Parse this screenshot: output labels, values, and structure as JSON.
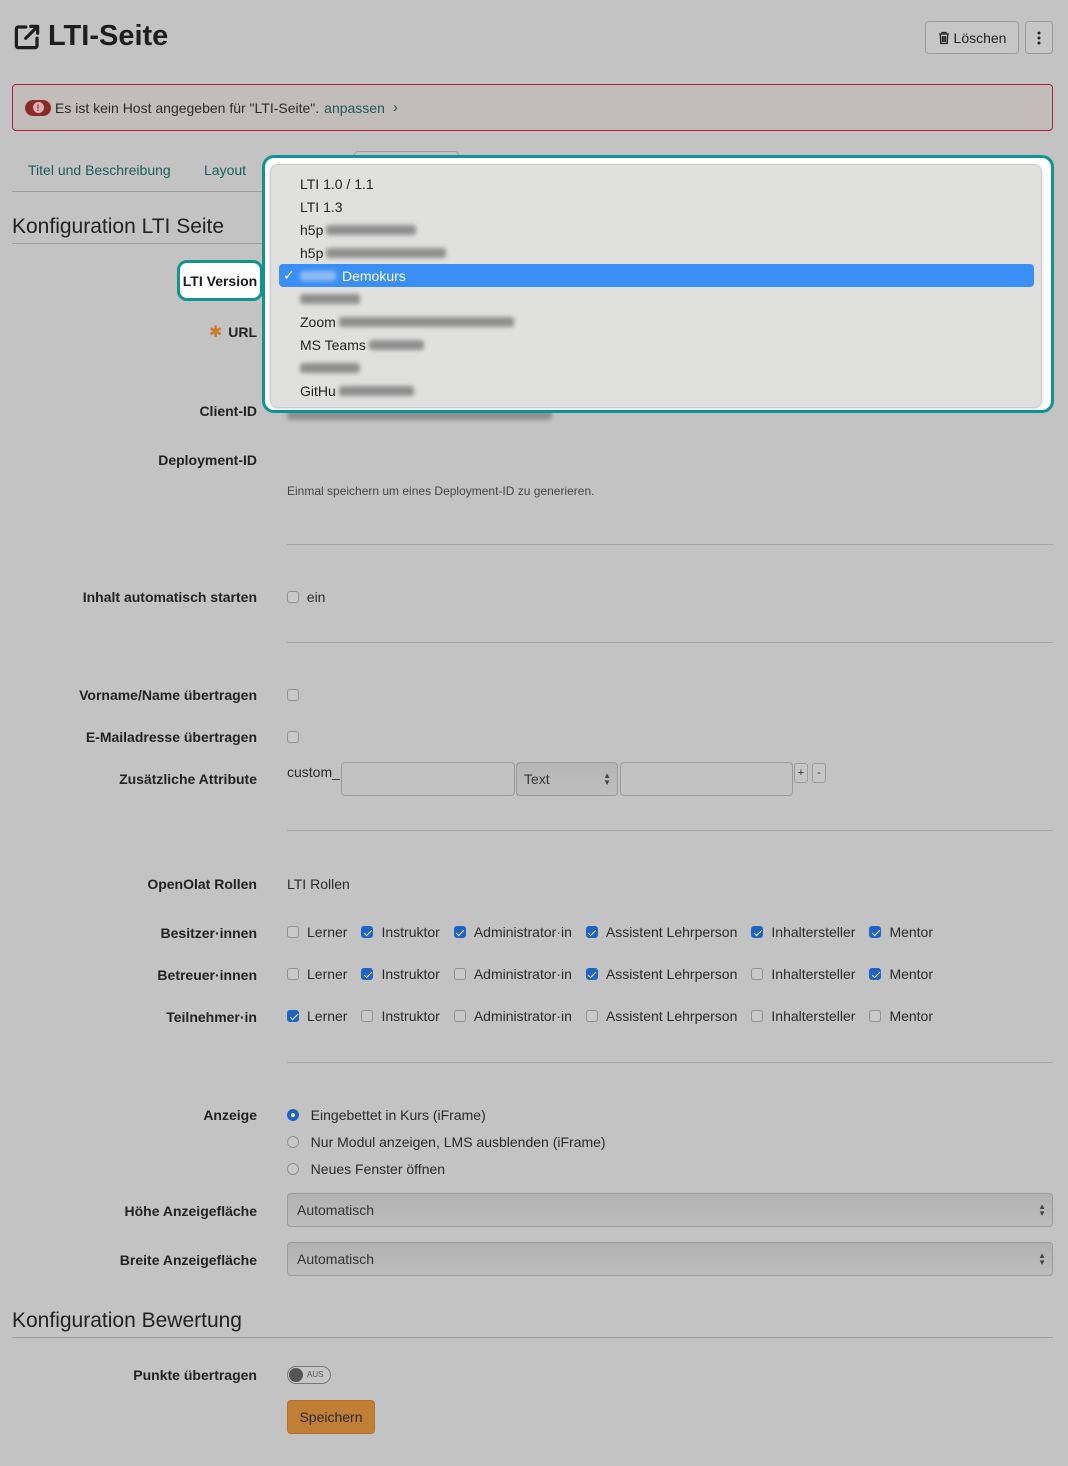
{
  "header": {
    "title": "LTI-Seite",
    "delete_label": "Löschen"
  },
  "alert": {
    "message": "Es ist kein Host angegeben für \"LTI-Seite\".",
    "link": "anpassen"
  },
  "tabs": [
    {
      "label": "Titel und Beschreibung"
    },
    {
      "label": "Layout"
    }
  ],
  "config_section": {
    "title": "Konfiguration LTI Seite",
    "fields": {
      "lti_version": "LTI Version",
      "url": "URL",
      "client_id": "Client-ID",
      "deployment_id": "Deployment-ID",
      "deployment_hint": "Einmal speichern um eines Deployment-ID zu generieren.",
      "autostart": "Inhalt automatisch starten",
      "autostart_option": "ein",
      "send_name": "Vorname/Name übertragen",
      "send_email": "E-Mailadresse übertragen",
      "custom_attrs": "Zusätzliche Attribute",
      "custom_prefix": "custom_",
      "custom_type": "Text",
      "add_label": "+",
      "remove_label": "-"
    }
  },
  "lti_version_dropdown": {
    "options": [
      {
        "label": "LTI 1.0 / 1.1",
        "selected": false,
        "redacted": false
      },
      {
        "label": "LTI 1.3",
        "selected": false,
        "redacted": false
      },
      {
        "label": "h5p",
        "selected": false,
        "redacted": true
      },
      {
        "label": "h5p",
        "selected": false,
        "redacted": true
      },
      {
        "label": "Demokurs",
        "selected": true,
        "redacted": true
      },
      {
        "label": "",
        "selected": false,
        "redacted": true
      },
      {
        "label": "Zoom",
        "selected": false,
        "redacted": true
      },
      {
        "label": "MS Teams",
        "selected": false,
        "redacted": true
      },
      {
        "label": "",
        "selected": false,
        "redacted": true
      },
      {
        "label": "GitHu",
        "selected": false,
        "redacted": true
      }
    ],
    "check_glyph": "✓"
  },
  "roles": {
    "header_left": "OpenOlat Rollen",
    "header_right": "LTI Rollen",
    "columns": [
      "Lerner",
      "Instruktor",
      "Administrator·in",
      "Assistent Lehrperson",
      "Inhaltersteller",
      "Mentor"
    ],
    "rows": [
      {
        "label": "Besitzer·innen",
        "checked": [
          false,
          true,
          true,
          true,
          true,
          true
        ]
      },
      {
        "label": "Betreuer·innen",
        "checked": [
          false,
          true,
          false,
          true,
          false,
          true
        ]
      },
      {
        "label": "Teilnehmer·in",
        "checked": [
          true,
          false,
          false,
          false,
          false,
          false
        ]
      }
    ]
  },
  "display": {
    "label": "Anzeige",
    "options": [
      {
        "label": "Eingebettet in Kurs (iFrame)",
        "selected": true
      },
      {
        "label": "Nur Modul anzeigen, LMS ausblenden (iFrame)",
        "selected": false
      },
      {
        "label": "Neues Fenster öffnen",
        "selected": false
      }
    ],
    "height_label": "Höhe Anzeigefläche",
    "height_value": "Automatisch",
    "width_label": "Breite Anzeigefläche",
    "width_value": "Automatisch"
  },
  "grading_section": {
    "title": "Konfiguration Bewertung",
    "points_label": "Punkte übertragen",
    "toggle_text": "AUS",
    "toggle_on": false,
    "save_label": "Speichern"
  },
  "colors": {
    "accent": "#1e5b5a",
    "highlight": "#10948d",
    "selected_option": "#3a8ff6",
    "save_button": "#c07f35",
    "alert_border": "#b0203a"
  }
}
